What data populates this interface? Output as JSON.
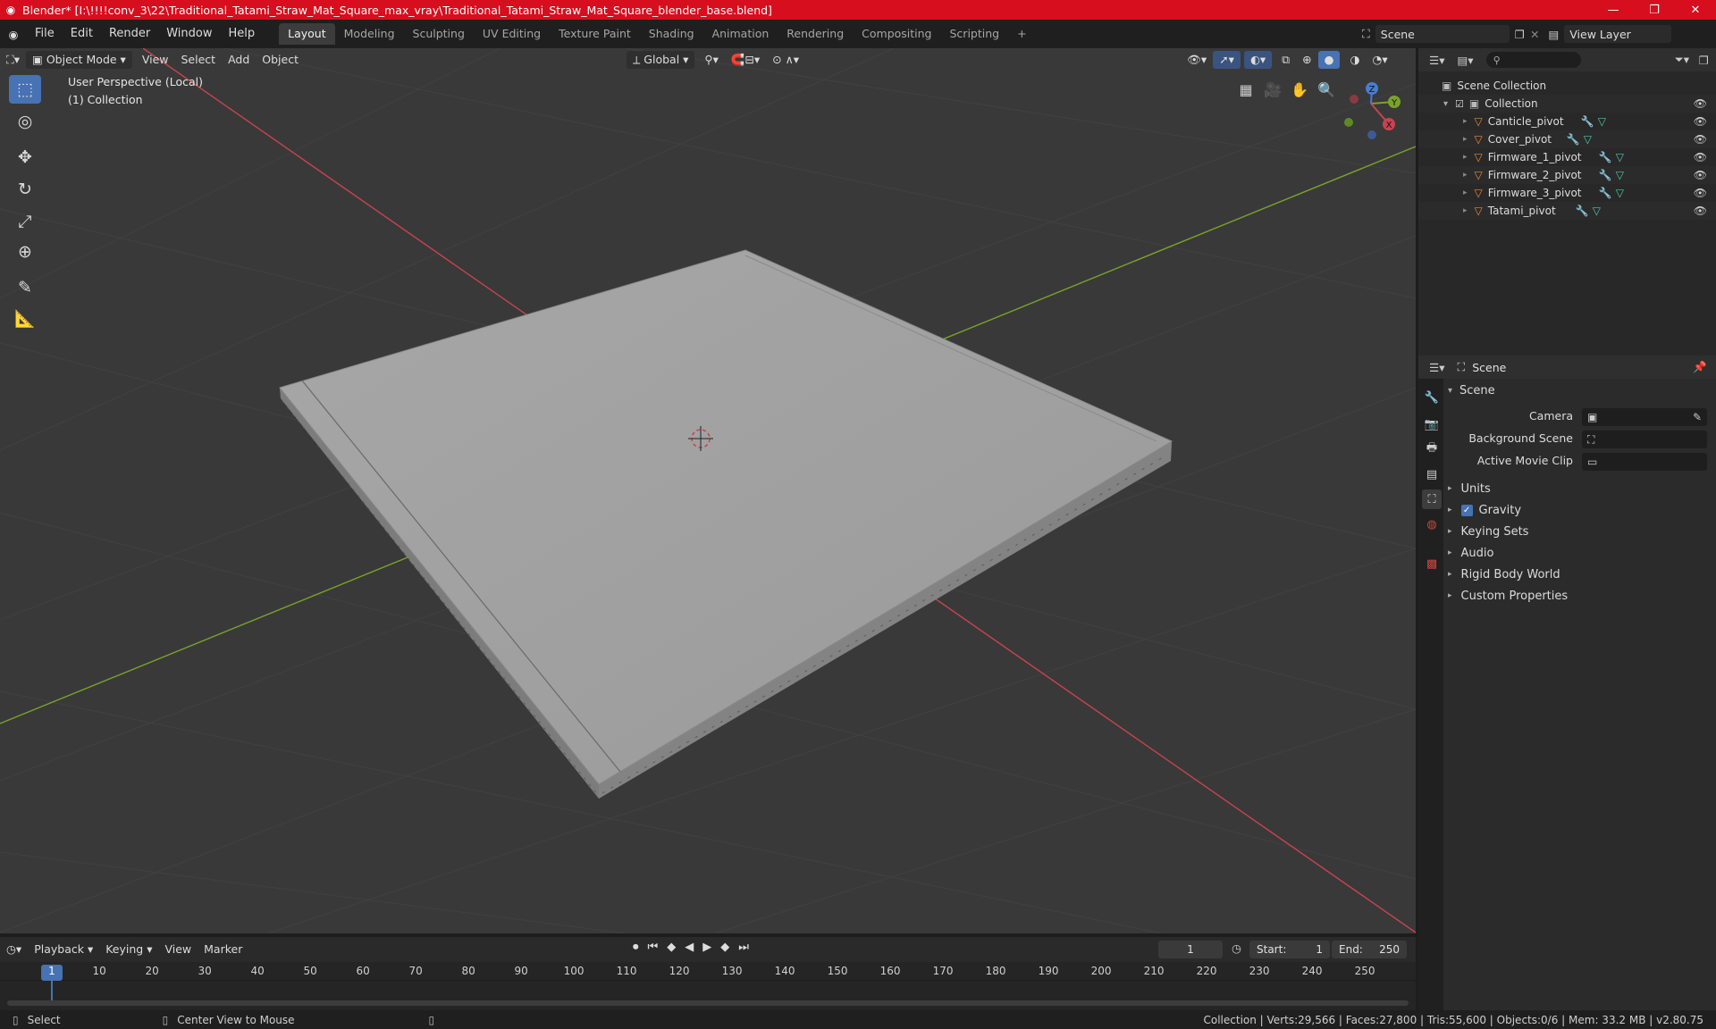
{
  "titlebar": {
    "title": "Blender* [I:\\!!!!conv_3\\22\\Traditional_Tatami_Straw_Mat_Square_max_vray\\Traditional_Tatami_Straw_Mat_Square_blender_base.blend]",
    "min_icon": "—",
    "max_icon": "❐",
    "close_icon": "✕"
  },
  "menu": [
    "File",
    "Edit",
    "Render",
    "Window",
    "Help"
  ],
  "workspaces": [
    "Layout",
    "Modeling",
    "Sculpting",
    "UV Editing",
    "Texture Paint",
    "Shading",
    "Animation",
    "Rendering",
    "Compositing",
    "Scripting"
  ],
  "add_workspace": "+",
  "scene_name": "Scene",
  "view_layer": "View Layer",
  "viewport": {
    "mode": "Object Mode",
    "menus": [
      "View",
      "Select",
      "Add",
      "Object"
    ],
    "orientation": "Global",
    "overlay_line1": "User Perspective (Local)",
    "overlay_line2": "(1) Collection",
    "gizmo_labels": {
      "x": "X",
      "y": "Y",
      "z": "Z"
    }
  },
  "outliner": {
    "root": "Scene Collection",
    "collection": "Collection",
    "items": [
      "Canticle_pivot",
      "Cover_pivot",
      "Firmware_1_pivot",
      "Firmware_2_pivot",
      "Firmware_3_pivot",
      "Tatami_pivot"
    ]
  },
  "properties": {
    "header": "Scene",
    "section": "Scene",
    "camera_label": "Camera",
    "background_label": "Background Scene",
    "clip_label": "Active Movie Clip",
    "subsections": [
      "Units",
      "Gravity",
      "Keying Sets",
      "Audio",
      "Rigid Body World",
      "Custom Properties"
    ]
  },
  "timeline": {
    "menus": [
      "Playback",
      "Keying",
      "View",
      "Marker"
    ],
    "current_frame": "1",
    "start_label": "Start:",
    "start": "1",
    "end_label": "End:",
    "end": "250",
    "ticks": [
      "1",
      "10",
      "20",
      "30",
      "40",
      "50",
      "60",
      "70",
      "80",
      "90",
      "100",
      "110",
      "120",
      "130",
      "140",
      "150",
      "160",
      "170",
      "180",
      "190",
      "200",
      "210",
      "220",
      "230",
      "240",
      "250"
    ]
  },
  "status": {
    "select": "Select",
    "center": "Center View to Mouse",
    "stats": "Collection | Verts:29,566 | Faces:27,800 | Tris:55,600 | Objects:0/6 | Mem: 33.2 MB | v2.80.75"
  },
  "colors": {
    "title_red": "#d70e1d",
    "accent_blue": "#4772b3",
    "mesh_orange": "#e8883a",
    "axis_red": "#c8434f",
    "axis_green": "#7aa32a"
  }
}
